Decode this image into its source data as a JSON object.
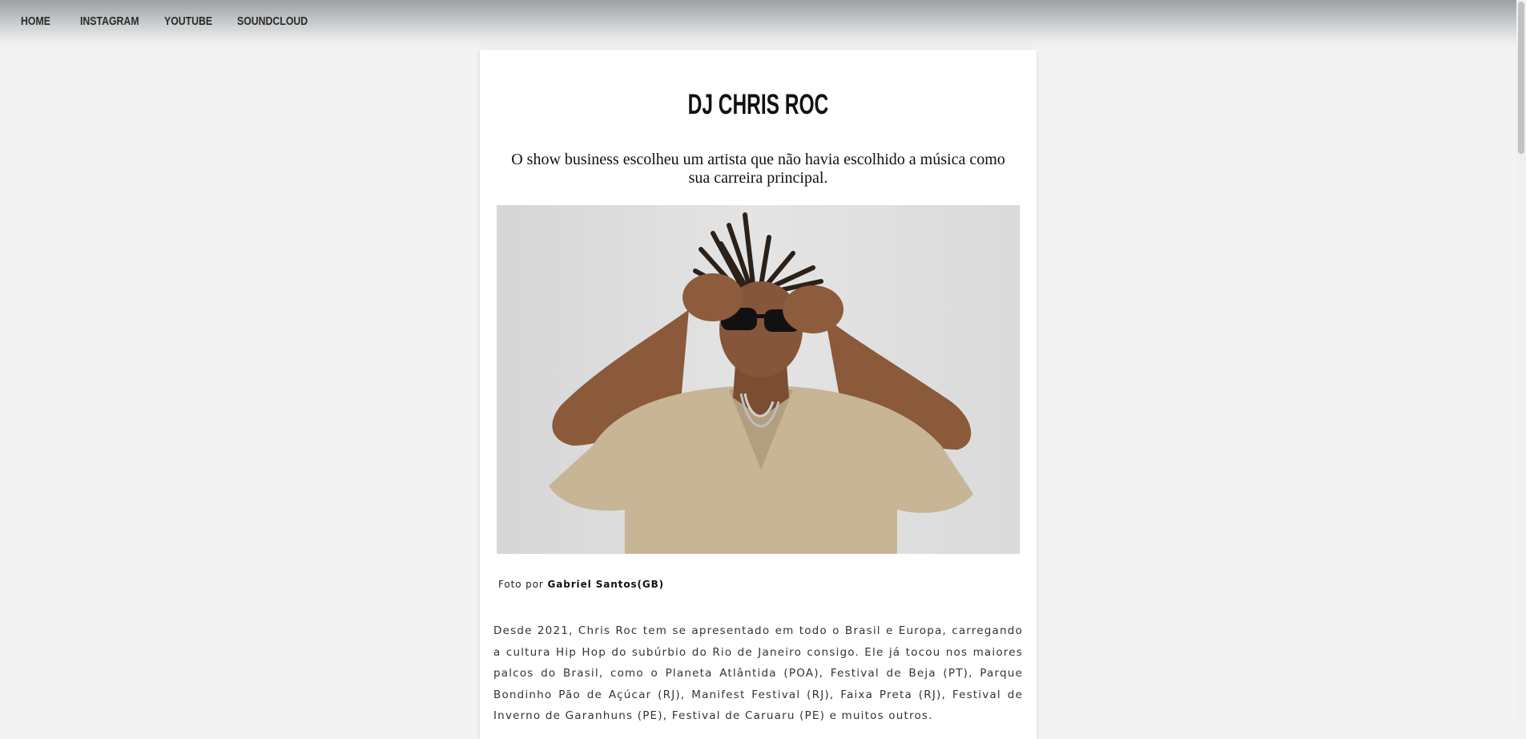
{
  "nav": {
    "items": [
      {
        "label": "HOME"
      },
      {
        "label": "INSTAGRAM"
      },
      {
        "label": "YOUTUBE"
      },
      {
        "label": "SOUNDCLOUD"
      }
    ]
  },
  "content": {
    "title": "DJ CHRIS ROC",
    "subtitle": "O show business escolheu um artista que não havia escolhido a música como sua carreira principal.",
    "caption_prefix": "Foto por ",
    "caption_author": "Gabriel Santos(GB)",
    "bio": " Desde 2021, Chris Roc tem se apresentado em todo o Brasil e Europa, carregando a cultura Hip Hop do subúrbio do Rio de Janeiro consigo. Ele já tocou nos maiores palcos do Brasil, como o Planeta Atlântida (POA), Festival de Beja (PT), Parque Bondinho Pão de Açúcar (RJ), Manifest Festival (RJ), Faixa Preta (RJ), Festival de Inverno de Garanhuns (PE), Festival de Caruaru (PE) e muitos outros."
  },
  "colors": {
    "page_bg": "#f3f3f3",
    "card_bg": "#ffffff",
    "nav_text": "#2a2a2a"
  }
}
